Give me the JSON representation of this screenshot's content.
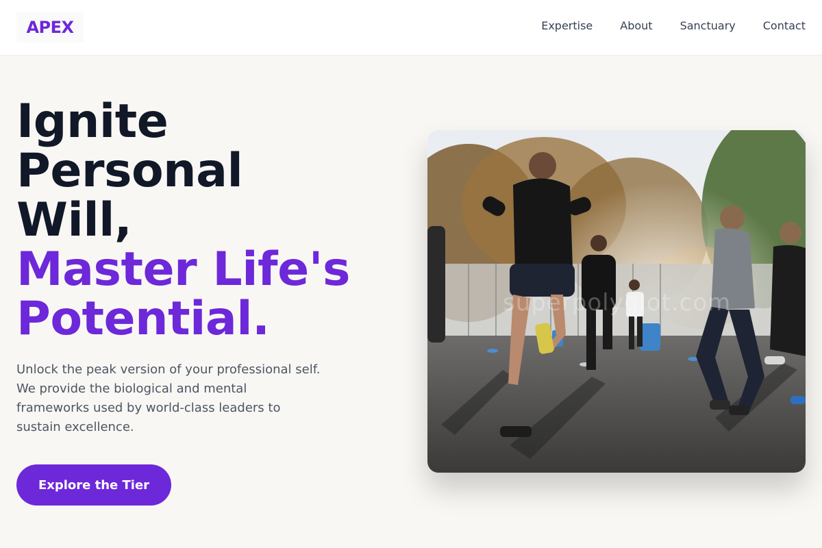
{
  "header": {
    "logo": "APEX",
    "nav": [
      {
        "label": "Expertise"
      },
      {
        "label": "About"
      },
      {
        "label": "Sanctuary"
      },
      {
        "label": "Contact"
      }
    ]
  },
  "hero": {
    "title_lines": [
      "Ignite",
      "Personal",
      "Will,"
    ],
    "accent_lines": [
      "Master Life's",
      "Potential."
    ],
    "description_lines": [
      "Unlock the peak version of your professional self.",
      "We provide the biological and mental",
      "frameworks used by world-class leaders to",
      "sustain excellence."
    ],
    "cta_label": "Explore the Tier"
  },
  "image": {
    "subject": "group outdoor running training",
    "watermark": "superpolyglot.com"
  },
  "colors": {
    "accent": "#6d28d9",
    "heading": "#111827",
    "body_text": "#4b5563",
    "page_bg": "#f9f7f4"
  }
}
